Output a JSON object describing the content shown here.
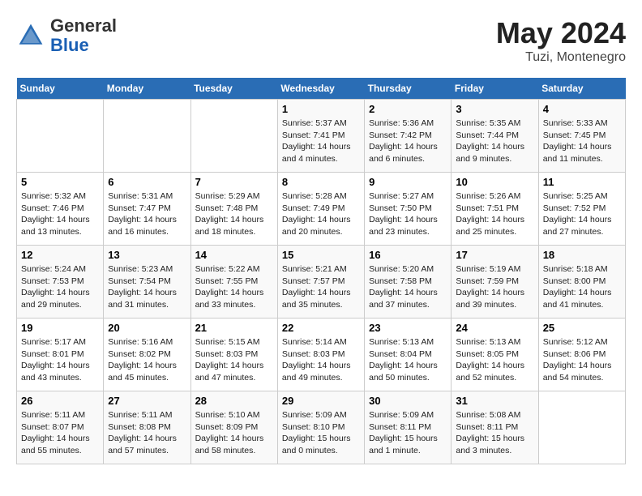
{
  "header": {
    "logo_general": "General",
    "logo_blue": "Blue",
    "month_title": "May 2024",
    "location": "Tuzi, Montenegro"
  },
  "days_of_week": [
    "Sunday",
    "Monday",
    "Tuesday",
    "Wednesday",
    "Thursday",
    "Friday",
    "Saturday"
  ],
  "weeks": [
    [
      {
        "day": "",
        "sunrise": "",
        "sunset": "",
        "daylight": ""
      },
      {
        "day": "",
        "sunrise": "",
        "sunset": "",
        "daylight": ""
      },
      {
        "day": "",
        "sunrise": "",
        "sunset": "",
        "daylight": ""
      },
      {
        "day": "1",
        "sunrise": "Sunrise: 5:37 AM",
        "sunset": "Sunset: 7:41 PM",
        "daylight": "Daylight: 14 hours and 4 minutes."
      },
      {
        "day": "2",
        "sunrise": "Sunrise: 5:36 AM",
        "sunset": "Sunset: 7:42 PM",
        "daylight": "Daylight: 14 hours and 6 minutes."
      },
      {
        "day": "3",
        "sunrise": "Sunrise: 5:35 AM",
        "sunset": "Sunset: 7:44 PM",
        "daylight": "Daylight: 14 hours and 9 minutes."
      },
      {
        "day": "4",
        "sunrise": "Sunrise: 5:33 AM",
        "sunset": "Sunset: 7:45 PM",
        "daylight": "Daylight: 14 hours and 11 minutes."
      }
    ],
    [
      {
        "day": "5",
        "sunrise": "Sunrise: 5:32 AM",
        "sunset": "Sunset: 7:46 PM",
        "daylight": "Daylight: 14 hours and 13 minutes."
      },
      {
        "day": "6",
        "sunrise": "Sunrise: 5:31 AM",
        "sunset": "Sunset: 7:47 PM",
        "daylight": "Daylight: 14 hours and 16 minutes."
      },
      {
        "day": "7",
        "sunrise": "Sunrise: 5:29 AM",
        "sunset": "Sunset: 7:48 PM",
        "daylight": "Daylight: 14 hours and 18 minutes."
      },
      {
        "day": "8",
        "sunrise": "Sunrise: 5:28 AM",
        "sunset": "Sunset: 7:49 PM",
        "daylight": "Daylight: 14 hours and 20 minutes."
      },
      {
        "day": "9",
        "sunrise": "Sunrise: 5:27 AM",
        "sunset": "Sunset: 7:50 PM",
        "daylight": "Daylight: 14 hours and 23 minutes."
      },
      {
        "day": "10",
        "sunrise": "Sunrise: 5:26 AM",
        "sunset": "Sunset: 7:51 PM",
        "daylight": "Daylight: 14 hours and 25 minutes."
      },
      {
        "day": "11",
        "sunrise": "Sunrise: 5:25 AM",
        "sunset": "Sunset: 7:52 PM",
        "daylight": "Daylight: 14 hours and 27 minutes."
      }
    ],
    [
      {
        "day": "12",
        "sunrise": "Sunrise: 5:24 AM",
        "sunset": "Sunset: 7:53 PM",
        "daylight": "Daylight: 14 hours and 29 minutes."
      },
      {
        "day": "13",
        "sunrise": "Sunrise: 5:23 AM",
        "sunset": "Sunset: 7:54 PM",
        "daylight": "Daylight: 14 hours and 31 minutes."
      },
      {
        "day": "14",
        "sunrise": "Sunrise: 5:22 AM",
        "sunset": "Sunset: 7:55 PM",
        "daylight": "Daylight: 14 hours and 33 minutes."
      },
      {
        "day": "15",
        "sunrise": "Sunrise: 5:21 AM",
        "sunset": "Sunset: 7:57 PM",
        "daylight": "Daylight: 14 hours and 35 minutes."
      },
      {
        "day": "16",
        "sunrise": "Sunrise: 5:20 AM",
        "sunset": "Sunset: 7:58 PM",
        "daylight": "Daylight: 14 hours and 37 minutes."
      },
      {
        "day": "17",
        "sunrise": "Sunrise: 5:19 AM",
        "sunset": "Sunset: 7:59 PM",
        "daylight": "Daylight: 14 hours and 39 minutes."
      },
      {
        "day": "18",
        "sunrise": "Sunrise: 5:18 AM",
        "sunset": "Sunset: 8:00 PM",
        "daylight": "Daylight: 14 hours and 41 minutes."
      }
    ],
    [
      {
        "day": "19",
        "sunrise": "Sunrise: 5:17 AM",
        "sunset": "Sunset: 8:01 PM",
        "daylight": "Daylight: 14 hours and 43 minutes."
      },
      {
        "day": "20",
        "sunrise": "Sunrise: 5:16 AM",
        "sunset": "Sunset: 8:02 PM",
        "daylight": "Daylight: 14 hours and 45 minutes."
      },
      {
        "day": "21",
        "sunrise": "Sunrise: 5:15 AM",
        "sunset": "Sunset: 8:03 PM",
        "daylight": "Daylight: 14 hours and 47 minutes."
      },
      {
        "day": "22",
        "sunrise": "Sunrise: 5:14 AM",
        "sunset": "Sunset: 8:03 PM",
        "daylight": "Daylight: 14 hours and 49 minutes."
      },
      {
        "day": "23",
        "sunrise": "Sunrise: 5:13 AM",
        "sunset": "Sunset: 8:04 PM",
        "daylight": "Daylight: 14 hours and 50 minutes."
      },
      {
        "day": "24",
        "sunrise": "Sunrise: 5:13 AM",
        "sunset": "Sunset: 8:05 PM",
        "daylight": "Daylight: 14 hours and 52 minutes."
      },
      {
        "day": "25",
        "sunrise": "Sunrise: 5:12 AM",
        "sunset": "Sunset: 8:06 PM",
        "daylight": "Daylight: 14 hours and 54 minutes."
      }
    ],
    [
      {
        "day": "26",
        "sunrise": "Sunrise: 5:11 AM",
        "sunset": "Sunset: 8:07 PM",
        "daylight": "Daylight: 14 hours and 55 minutes."
      },
      {
        "day": "27",
        "sunrise": "Sunrise: 5:11 AM",
        "sunset": "Sunset: 8:08 PM",
        "daylight": "Daylight: 14 hours and 57 minutes."
      },
      {
        "day": "28",
        "sunrise": "Sunrise: 5:10 AM",
        "sunset": "Sunset: 8:09 PM",
        "daylight": "Daylight: 14 hours and 58 minutes."
      },
      {
        "day": "29",
        "sunrise": "Sunrise: 5:09 AM",
        "sunset": "Sunset: 8:10 PM",
        "daylight": "Daylight: 15 hours and 0 minutes."
      },
      {
        "day": "30",
        "sunrise": "Sunrise: 5:09 AM",
        "sunset": "Sunset: 8:11 PM",
        "daylight": "Daylight: 15 hours and 1 minute."
      },
      {
        "day": "31",
        "sunrise": "Sunrise: 5:08 AM",
        "sunset": "Sunset: 8:11 PM",
        "daylight": "Daylight: 15 hours and 3 minutes."
      },
      {
        "day": "",
        "sunrise": "",
        "sunset": "",
        "daylight": ""
      }
    ]
  ]
}
